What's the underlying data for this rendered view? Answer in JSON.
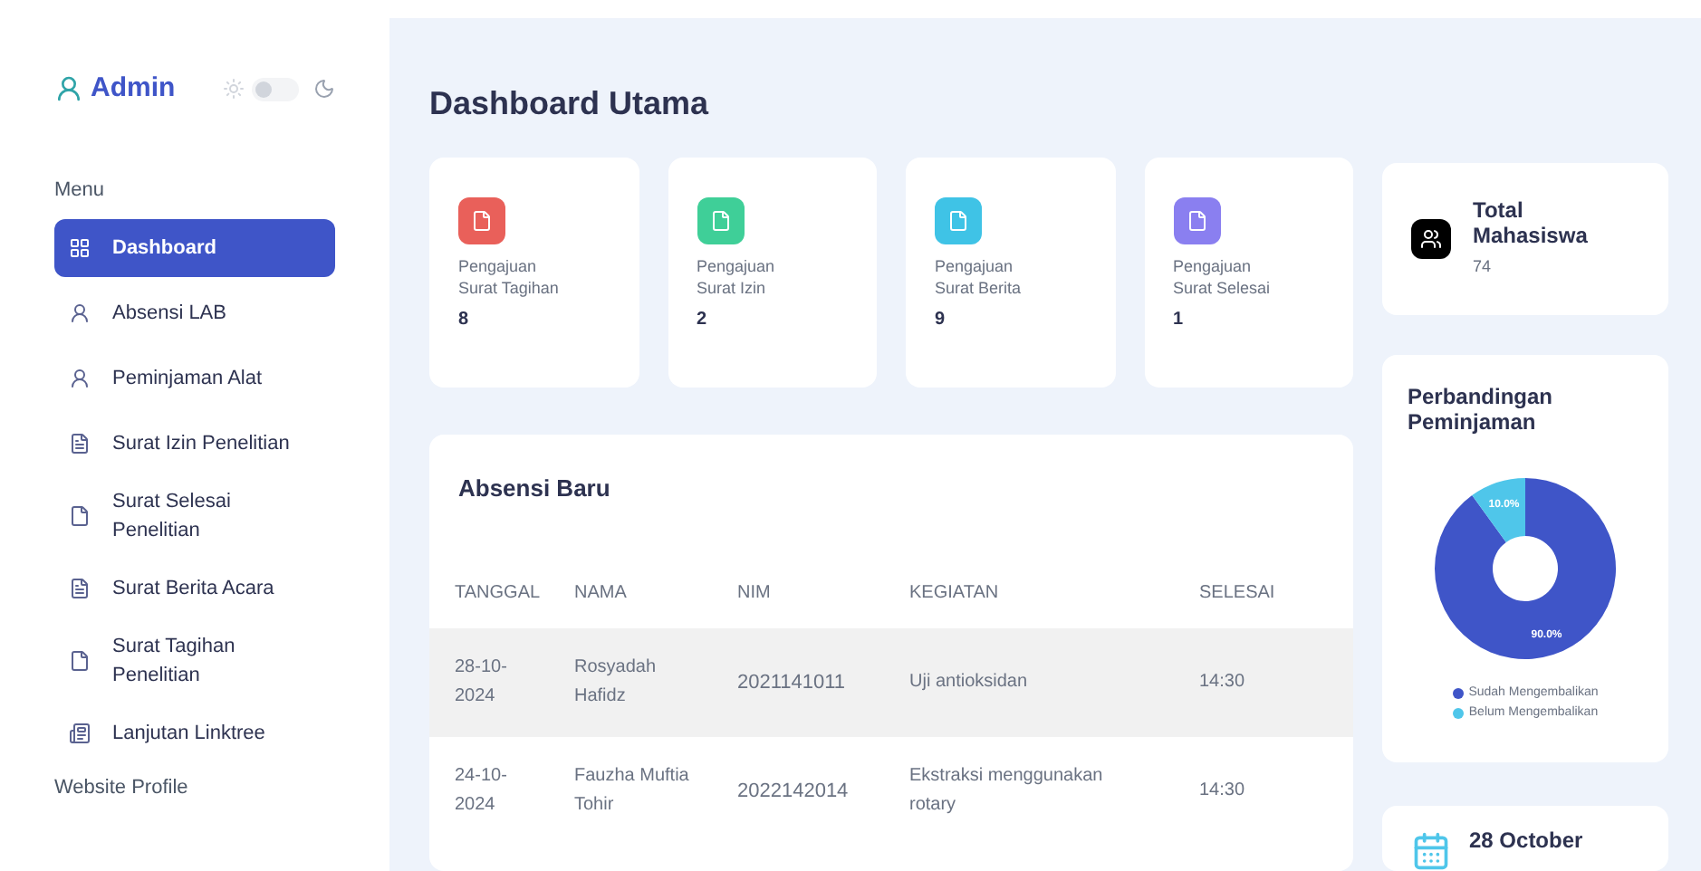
{
  "sidebar": {
    "user": "Admin",
    "theme_switch": {
      "on": false
    },
    "menu_heading": "Menu",
    "items": [
      {
        "label": "Dashboard",
        "selected": true
      },
      {
        "label": "Absensi LAB",
        "selected": false
      },
      {
        "label": "Peminjaman Alat",
        "selected": false
      },
      {
        "label": "Surat Izin Penelitian",
        "selected": false
      },
      {
        "label": "Surat Selesai Penelitian",
        "selected": false
      },
      {
        "label": "Surat Berita Acara",
        "selected": false
      },
      {
        "label": "Surat Tagihan Penelitian",
        "selected": false
      },
      {
        "label": "Lanjutan Linktree",
        "selected": false
      }
    ],
    "section_heading": "Website Profile"
  },
  "page_title": "Dashboard Utama",
  "stats": [
    {
      "label": "Pengajuan Surat Tagihan",
      "value": "8",
      "color": "#e9605a"
    },
    {
      "label": "Pengajuan Surat Izin",
      "value": "2",
      "color": "#3fcf98"
    },
    {
      "label": "Pengajuan Surat Berita",
      "value": "9",
      "color": "#3fc3e6"
    },
    {
      "label": "Pengajuan Surat Selesai",
      "value": "1",
      "color": "#8a7ff0"
    }
  ],
  "table": {
    "title": "Absensi Baru",
    "columns": [
      "TANGGAL",
      "NAMA",
      "NIM",
      "KEGIATAN",
      "SELESAI"
    ],
    "rows": [
      [
        "28-10-2024",
        "Rosyadah Hafidz",
        "2021141011",
        "Uji antioksidan",
        "14:30"
      ],
      [
        "24-10-2024",
        "Fauzha Muftia Tohir",
        "2022142014",
        "Ekstraksi menggunakan rotary",
        "14:30"
      ]
    ]
  },
  "total": {
    "title": "Total Mahasiswa",
    "value": "74"
  },
  "chart": {
    "title": "Perbandingan Peminjaman",
    "chart_data": {
      "type": "donut",
      "categories": [
        "Sudah Mengembalikan",
        "Belum Mengembalikan"
      ],
      "values": [
        90,
        10
      ],
      "colors": [
        "#3f55c8",
        "#4fc6ea"
      ],
      "value_labels": [
        "90.0%",
        "10.0%"
      ]
    }
  },
  "date": {
    "text": "28 October"
  }
}
